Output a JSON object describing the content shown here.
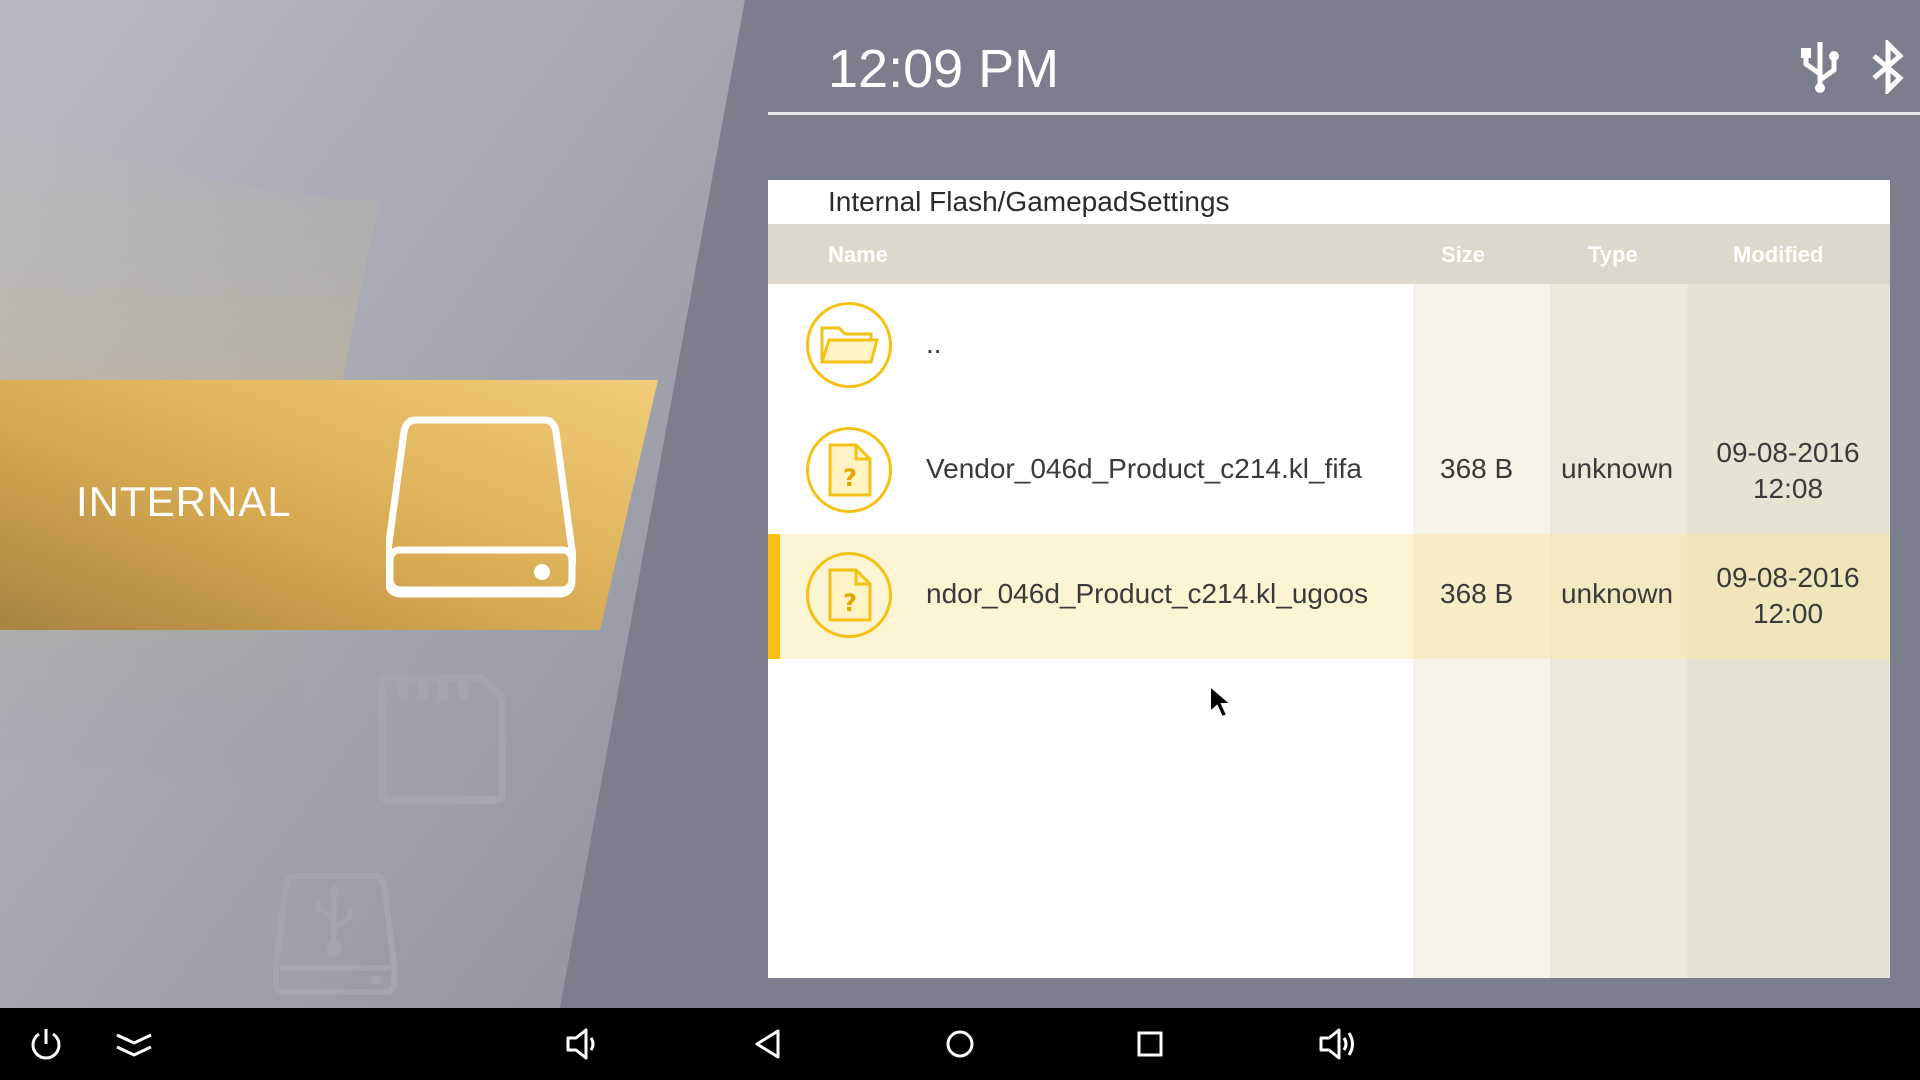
{
  "status_bar": {
    "time": "12:09 PM",
    "icons": [
      "usb-icon",
      "bluetooth-icon"
    ]
  },
  "sidebar": {
    "items": [
      {
        "label": "INTERNAL",
        "icon": "hard-drive-icon",
        "selected": true
      },
      {
        "label": "",
        "icon": "sd-card-icon",
        "selected": false
      },
      {
        "label": "",
        "icon": "usb-drive-icon",
        "selected": false
      }
    ]
  },
  "file_browser": {
    "path": "Internal Flash/GamepadSettings",
    "columns": {
      "name": "Name",
      "size": "Size",
      "type": "Type",
      "modified": "Modified"
    },
    "rows": [
      {
        "icon": "folder-icon",
        "name": "..",
        "size": "",
        "type": "",
        "modified_date": "",
        "modified_time": "",
        "selected": false
      },
      {
        "icon": "unknown-file-icon",
        "name": "Vendor_046d_Product_c214.kl_fifa",
        "size": "368 B",
        "type": "unknown",
        "modified_date": "09-08-2016",
        "modified_time": "12:08",
        "selected": false
      },
      {
        "icon": "unknown-file-icon",
        "name": "ndor_046d_Product_c214.kl_ugoos",
        "size": "368 B",
        "type": "unknown",
        "modified_date": "09-08-2016",
        "modified_time": "12:00",
        "selected": true
      }
    ]
  },
  "navigation_bar": {
    "buttons": [
      "power-icon",
      "menu-collapse-icon",
      "volume-down-icon",
      "back-icon",
      "home-icon",
      "recents-icon",
      "volume-up-icon"
    ]
  },
  "colors": {
    "accent": "#f5c213",
    "selected_band": "#d9a94a",
    "panel_header": "#dcd9cc",
    "background": "#7b7e8c",
    "nav_bar": "#000000"
  }
}
